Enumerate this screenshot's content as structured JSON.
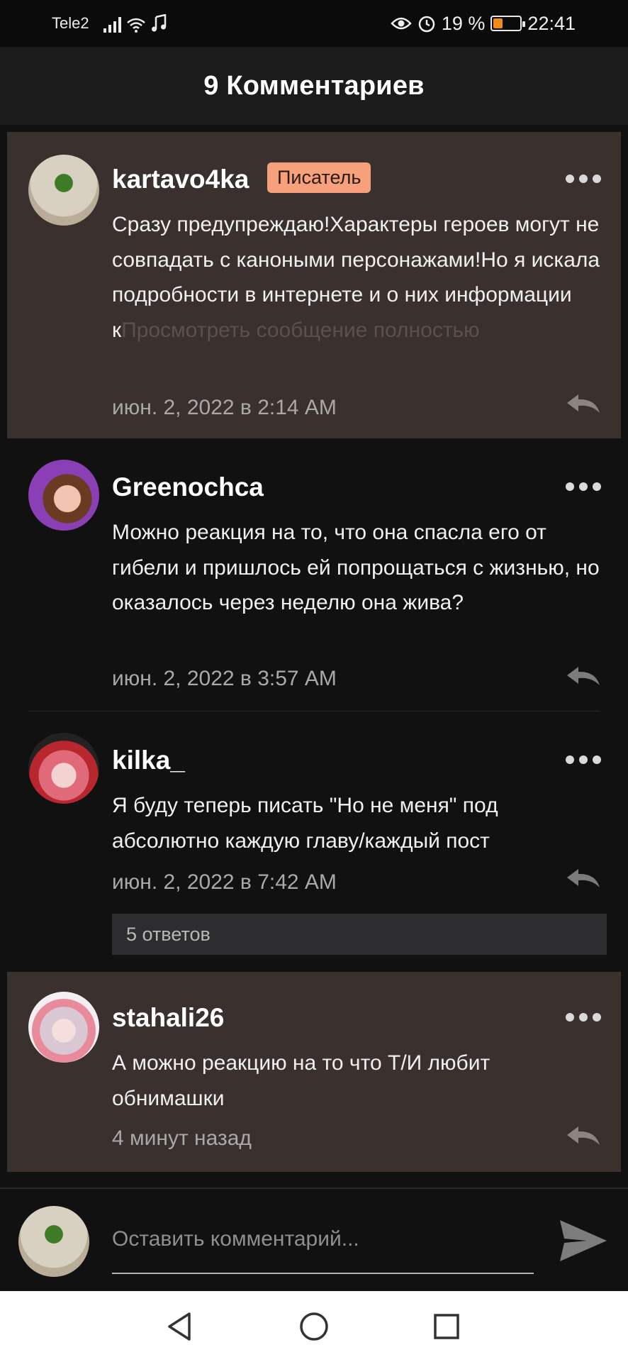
{
  "status_bar": {
    "carrier": "Tele2",
    "battery_percent": "19 %",
    "battery_level": 0.19,
    "time": "22:41",
    "icons": [
      "signal-icon",
      "wifi-icon",
      "music-note-icon",
      "eye-icon",
      "alarm-icon",
      "battery-icon"
    ]
  },
  "header": {
    "title": "9 Комментариев"
  },
  "comments": [
    {
      "username": "kartavo4ka",
      "badge": "Писатель",
      "text": "Сразу предупреждаю!Характеры героев могут не совпадать с каноными персонажами!Но я искала подробности в интернете и о них информации к",
      "more_link": "Просмотреть сообщение полностью",
      "date": "июн. 2, 2022 в 2:14 AM",
      "highlighted": true
    },
    {
      "username": "Greenochca",
      "text": "Можно реакция на то, что она спасла его от гибели и пришлось ей попрощаться с жизнью, но оказалось через неделю она жива?",
      "date": "июн. 2, 2022 в 3:57 AM"
    },
    {
      "username": "kilka_",
      "text": "Я буду теперь писать \"Но не меня\" под абсолютно каждую главу/каждый пост",
      "date": "июн. 2, 2022 в 7:42 AM",
      "replies_label": "5 ответов"
    },
    {
      "username": "stahali26",
      "text": "А можно реакцию на то что Т/И любит обнимашки",
      "date": "4 минут назад",
      "highlighted": true
    }
  ],
  "composer": {
    "placeholder": "Оставить комментарий..."
  },
  "colors": {
    "highlight_bg": "#3a302d",
    "badge_bg": "#f7a17c",
    "background": "#121112",
    "header_bg": "#1c1b1c"
  }
}
